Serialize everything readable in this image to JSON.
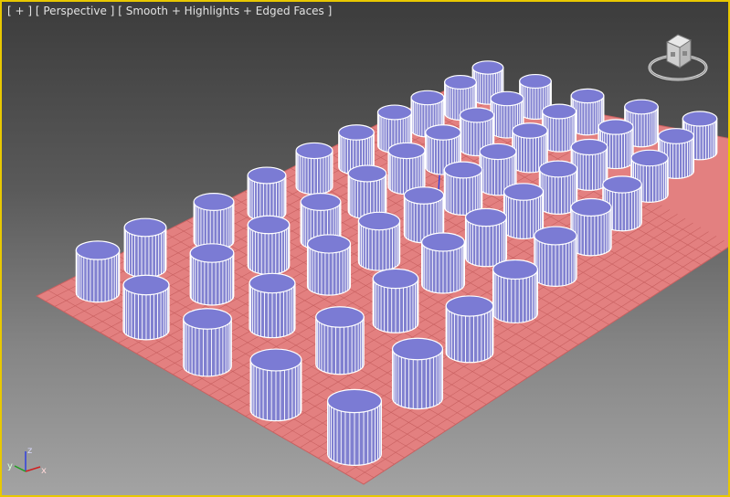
{
  "viewport": {
    "label_plus": "[ + ]",
    "label_view": "[ Perspective ]",
    "label_shading": "[ Smooth + Highlights + Edged Faces ]"
  },
  "axes": {
    "x": "x",
    "y": "y",
    "z": "z"
  },
  "colors": {
    "viewport_border": "#e8c800",
    "ground_plane": "#e38080",
    "grid_line": "#c86060",
    "cylinder_cap": "#7b7bd4",
    "cylinder_side": "#8080d0",
    "edge": "#ffffff",
    "axis_x": "#d02020",
    "axis_y": "#20a020",
    "axis_z": "#3040e0"
  },
  "icons": {
    "viewcube": "viewcube-icon",
    "tripod": "axis-tripod-icon"
  },
  "scene": {
    "object_type": "cylinder",
    "rows": 6,
    "cols": 9
  }
}
